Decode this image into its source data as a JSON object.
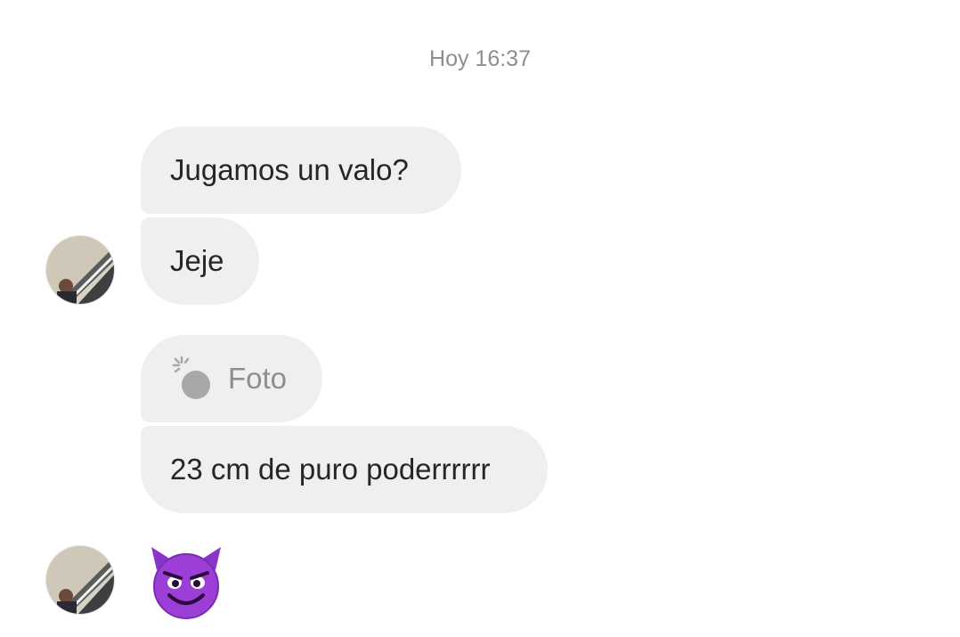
{
  "timestamp": "Hoy 16:37",
  "messages": [
    {
      "text": "Jugamos un valo?"
    },
    {
      "text": "Jeje"
    },
    {
      "text": "Foto",
      "icon": "photo-sparkle-icon"
    },
    {
      "text": "23 cm de puro poderrrrrr"
    }
  ],
  "reaction_emoji": "smiling-face-with-horns-icon",
  "colors": {
    "bubble_bg": "#efefef",
    "text": "#262626",
    "muted": "#8e8e8e",
    "emoji_purple": "#9b3fd6"
  }
}
